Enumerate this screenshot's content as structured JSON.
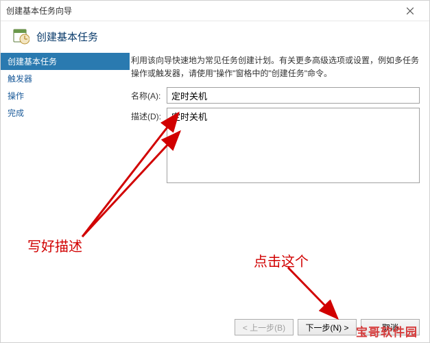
{
  "window": {
    "title": "创建基本任务向导",
    "close": "×"
  },
  "header": {
    "title": "创建基本任务"
  },
  "sidebar": {
    "items": [
      {
        "label": "创建基本任务",
        "active": true
      },
      {
        "label": "触发器",
        "active": false
      },
      {
        "label": "操作",
        "active": false
      },
      {
        "label": "完成",
        "active": false
      }
    ]
  },
  "content": {
    "intro": "利用该向导快速地为常见任务创建计划。有关更多高级选项或设置，例如多任务操作或触发器，请使用\"操作\"窗格中的\"创建任务\"命令。",
    "name_label": "名称(A):",
    "name_value": "定时关机",
    "desc_label": "描述(D):",
    "desc_value": "定时关机"
  },
  "footer": {
    "back": "< 上一步(B)",
    "next": "下一步(N) >",
    "cancel": "取消"
  },
  "annotations": {
    "desc": "写好描述",
    "click": "点击这个",
    "watermark": "宝哥软件园"
  }
}
